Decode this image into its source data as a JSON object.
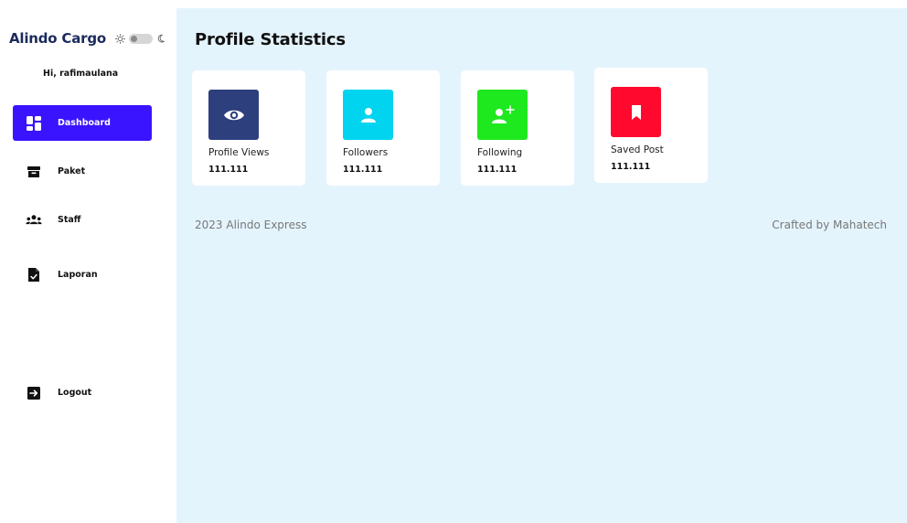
{
  "sidebar": {
    "brand": "Alindo Cargo",
    "theme_toggle": {
      "sun_icon": "sun-icon",
      "moon_icon": "moon-icon",
      "state": "light"
    },
    "greeting": "Hi, rafimaulana",
    "accent_color": "#3a14ff",
    "items": [
      {
        "label": "Dashboard",
        "icon": "dashboard-grid-icon",
        "active": true
      },
      {
        "label": "Paket",
        "icon": "archive-box-icon",
        "active": false
      },
      {
        "label": "Staff",
        "icon": "users-group-icon",
        "active": false
      },
      {
        "label": "Laporan",
        "icon": "file-check-icon",
        "active": false
      },
      {
        "label": "Logout",
        "icon": "logout-arrow-icon",
        "active": false
      }
    ]
  },
  "main": {
    "title": "Profile Statistics",
    "background_color": "#e4f4fd",
    "cards": [
      {
        "label": "Profile Views",
        "value": "111.111",
        "icon": "eye-icon",
        "color": "#2d3f7c"
      },
      {
        "label": "Followers",
        "value": "111.111",
        "icon": "user-icon",
        "color": "#00d4ef"
      },
      {
        "label": "Following",
        "value": "111.111",
        "icon": "user-plus-icon",
        "color": "#1ee81e"
      },
      {
        "label": "Saved Post",
        "value": "111.111",
        "icon": "bookmark-icon",
        "color": "#ff0a2e"
      }
    ],
    "footer_left": "2023 Alindo Express",
    "footer_right": "Crafted by Mahatech"
  }
}
